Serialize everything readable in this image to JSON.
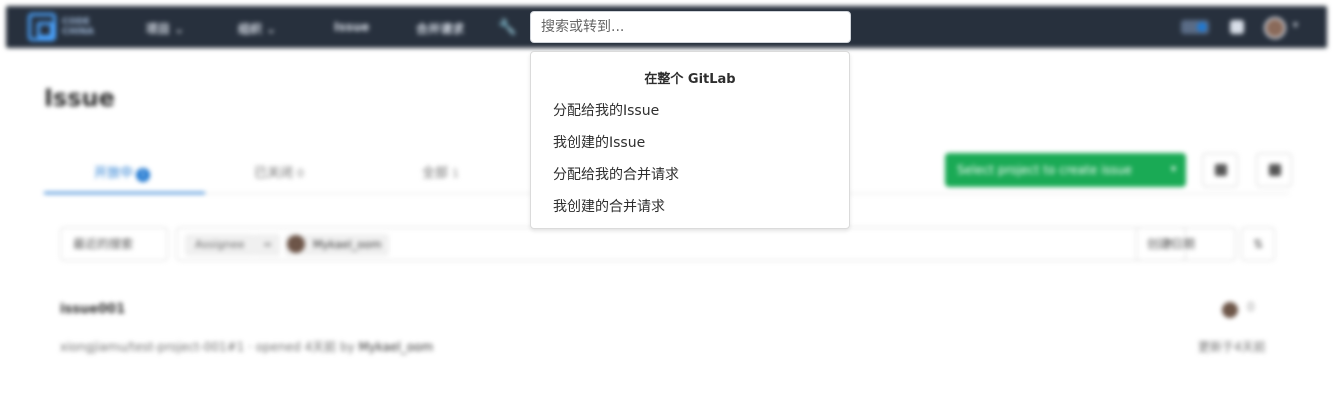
{
  "topbar": {
    "logo_text": "CODE CHINA",
    "nav": [
      "项目 ⌄",
      "组织 ⌄",
      "Issue",
      "合并请求"
    ],
    "search": {
      "placeholder": "搜索或转到...",
      "value": ""
    },
    "icons": [
      "wrench-icon",
      "todo-badge-icon",
      "issues-icon",
      "avatar"
    ]
  },
  "page": {
    "title": "Issue",
    "tabs": [
      {
        "label": "开放中",
        "count": "1"
      },
      {
        "label": "已关闭",
        "count": "0"
      },
      {
        "label": "全部",
        "count": "1"
      }
    ],
    "create_button": "Select project to create issue",
    "filter": {
      "recent_label": "最近的搜索",
      "token_key": "Assignee",
      "token_op": "=",
      "token_value": "Mykael_oom",
      "sort_label": "创建日期"
    },
    "issue": {
      "title": "issue001",
      "meta_prefix": "xiongjiamu/test-project-001#1 · opened 4天前 by",
      "author": "Mykael_oom",
      "updated": "更新于4天前",
      "comments": "0"
    }
  },
  "dropdown": {
    "header": "在整个 GitLab",
    "items": [
      "分配给我的Issue",
      "我创建的Issue",
      "分配给我的合并请求",
      "我创建的合并请求"
    ]
  },
  "colors": {
    "nav_bg": "#27303d",
    "accent": "#1f78d1",
    "create_green": "#1aaa55"
  }
}
